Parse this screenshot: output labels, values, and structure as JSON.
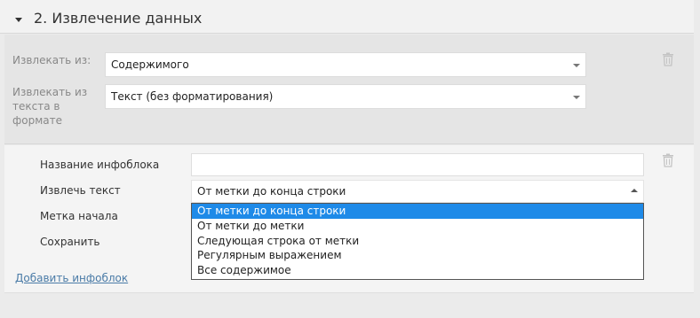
{
  "section": {
    "title": "2. Извлечение данных"
  },
  "source_group": {
    "extract_from_label": "Извлекать из:",
    "extract_from_value": "Содержимого",
    "format_label": "Извлекать из текста в формате",
    "format_value": "Текст (без форматирования)"
  },
  "infoblock": {
    "name_label": "Название инфоблока",
    "name_value": "",
    "extract_label": "Извлечь текст",
    "extract_value": "От метки до конца строки",
    "start_mark_label": "Метка начала",
    "save_label": "Сохранить",
    "options": [
      "От метки до конца строки",
      "От метки до метки",
      "Следующая строка от метки",
      "Регулярным выражением",
      "Все содержимое"
    ],
    "selected_index": 0
  },
  "add_infoblock_link": "Добавить инфоблок",
  "icons": {
    "collapse": "caret-down-icon",
    "delete": "trash-icon"
  },
  "colors": {
    "selected_option": "#1e8ae8",
    "link": "#4a7ba7"
  }
}
